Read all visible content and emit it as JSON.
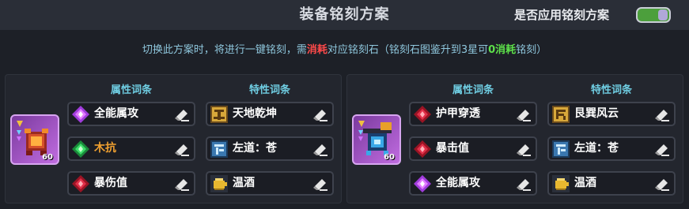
{
  "header": {
    "title": "装备铭刻方案",
    "toggle_label": "是否应用铭刻方案",
    "toggle_on": true
  },
  "notice": {
    "part1": "切换此方案时，将进行一键铭刻，需",
    "part2": "消耗",
    "part3": "对应铭刻石（铭刻石图鉴升到3星可",
    "part4": "0消耗",
    "part5": "铭刻）"
  },
  "plans": [
    {
      "attr_header": "属性词条",
      "trait_header": "特性词条",
      "gear_level": "60",
      "gear_icon": "red-armor-icon",
      "attributes": [
        {
          "label": "全能属攻",
          "color": "#ffffff",
          "icon": "purple-gem-icon"
        },
        {
          "label": "木抗",
          "color": "#f0a030",
          "icon": "green-gem-icon"
        },
        {
          "label": "暴伤值",
          "color": "#ffffff",
          "icon": "red-gem-icon"
        }
      ],
      "traits": [
        {
          "label": "天地乾坤",
          "icon": "heaven-earth-icon"
        },
        {
          "label": "左道：苍",
          "icon": "left-path-icon"
        },
        {
          "label": "温酒",
          "icon": "warm-wine-icon"
        }
      ]
    },
    {
      "attr_header": "属性词条",
      "trait_header": "特性词条",
      "gear_level": "60",
      "gear_icon": "blue-weapon-icon",
      "attributes": [
        {
          "label": "护甲穿透",
          "color": "#ffffff",
          "icon": "red-gem-icon"
        },
        {
          "label": "暴击值",
          "color": "#ffffff",
          "icon": "red-gem-icon"
        },
        {
          "label": "全能属攻",
          "color": "#ffffff",
          "icon": "purple-gem-icon"
        }
      ],
      "traits": [
        {
          "label": "艮巽风云",
          "icon": "wind-cloud-icon"
        },
        {
          "label": "左道：苍",
          "icon": "left-path-icon"
        },
        {
          "label": "温酒",
          "icon": "warm-wine-icon"
        }
      ]
    }
  ],
  "colors": {
    "background": "#1d2027",
    "accent_cyan": "#6fcde2",
    "cost_red": "#ff4a4a",
    "free_green": "#5de14a",
    "toggle_green": "#4c9f3c"
  }
}
